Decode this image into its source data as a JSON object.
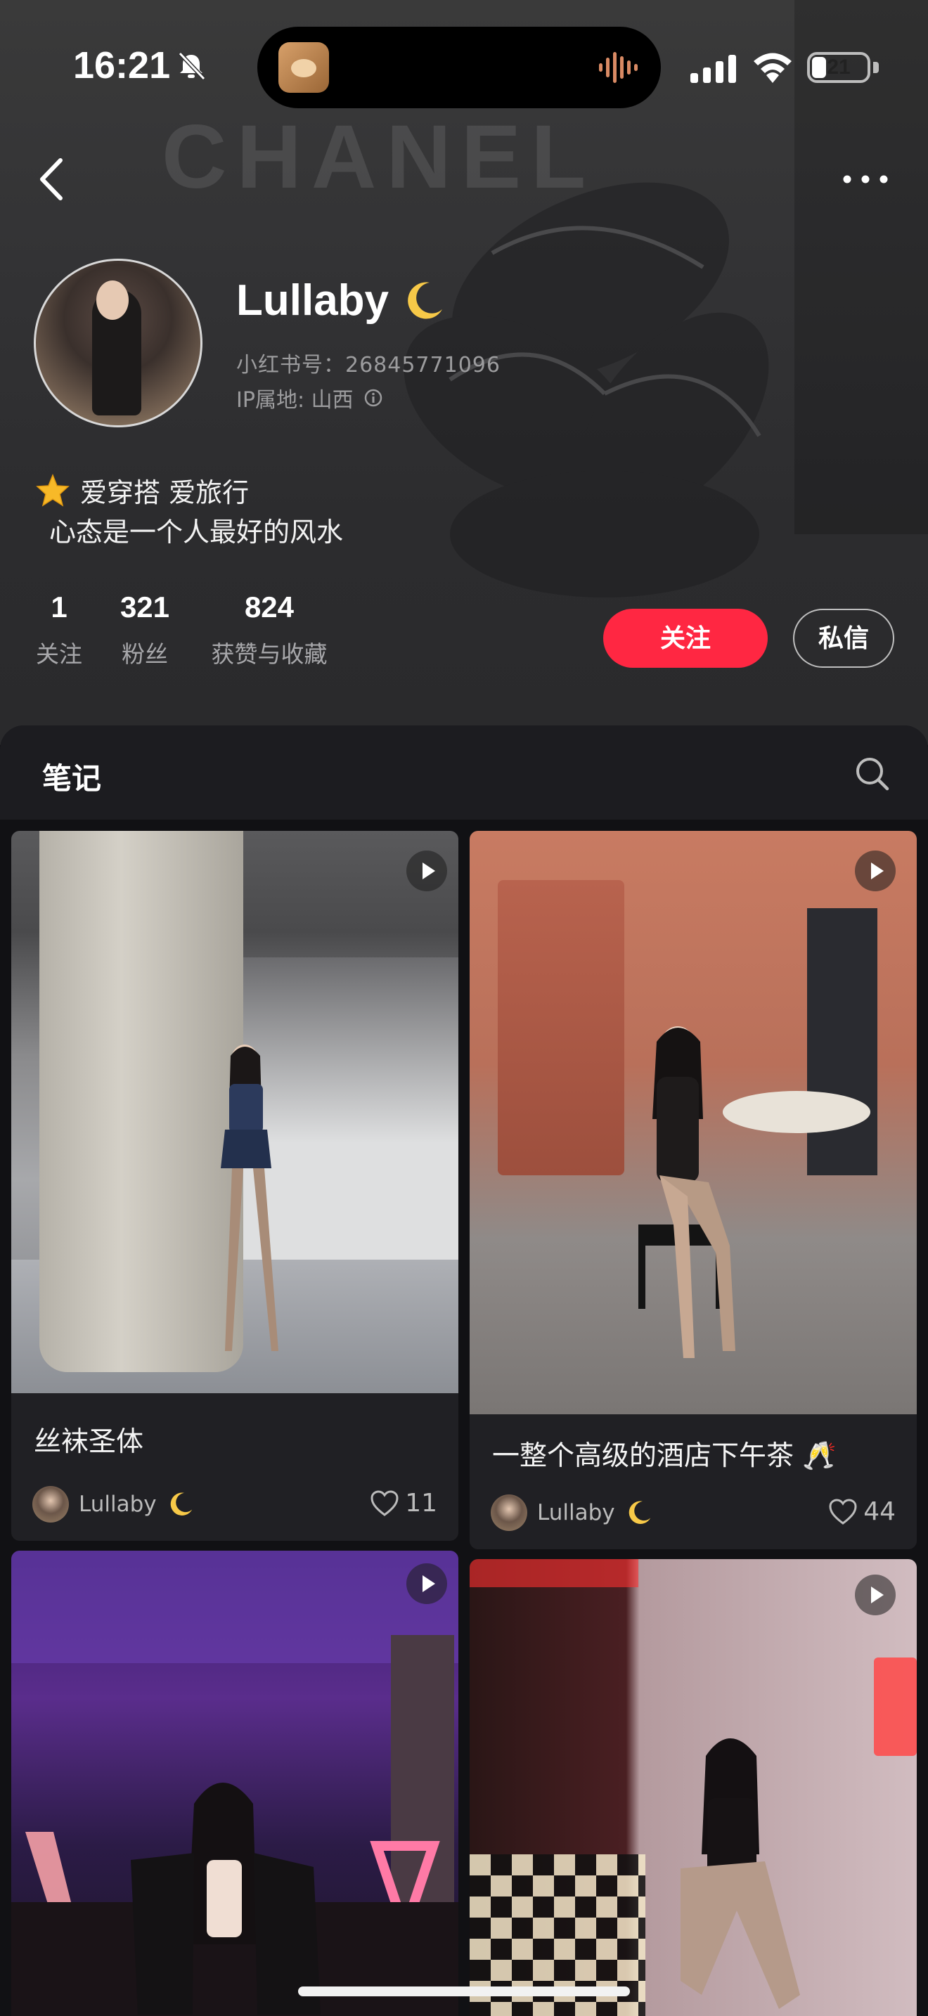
{
  "status_bar": {
    "time": "16:21",
    "battery": "21"
  },
  "hero": {
    "background_word": "CHANEL"
  },
  "profile": {
    "name": "Lullaby",
    "xhs_id": "小红书号：26845771096",
    "ip_location": "IP属地: 山西",
    "bio_line1": "爱穿搭 爱旅行",
    "bio_line2": "心态是一个人最好的风水"
  },
  "stats": [
    {
      "value": "1",
      "label": "关注"
    },
    {
      "value": "321",
      "label": "粉丝"
    },
    {
      "value": "824",
      "label": "获赞与收藏"
    }
  ],
  "actions": {
    "follow": "关注",
    "message": "私信"
  },
  "notes_tab": {
    "label": "笔记"
  },
  "notes": [
    {
      "title": "丝袜圣体",
      "author": "Lullaby",
      "likes": "11"
    },
    {
      "title": "一整个高级的酒店下午茶 🥂",
      "author": "Lullaby",
      "likes": "44"
    },
    {
      "title": "",
      "author": "",
      "likes": ""
    },
    {
      "title": "",
      "author": "",
      "likes": ""
    }
  ],
  "colors": {
    "accent": "#ff2742",
    "background": "#111114",
    "card": "#202024"
  },
  "icons": [
    "dnd-bell-off-icon",
    "signal-icon",
    "wifi-icon",
    "battery-icon",
    "back-chevron-icon",
    "more-dots-icon",
    "moon-icon",
    "info-icon",
    "star-icon",
    "search-icon",
    "play-icon",
    "heart-icon"
  ]
}
